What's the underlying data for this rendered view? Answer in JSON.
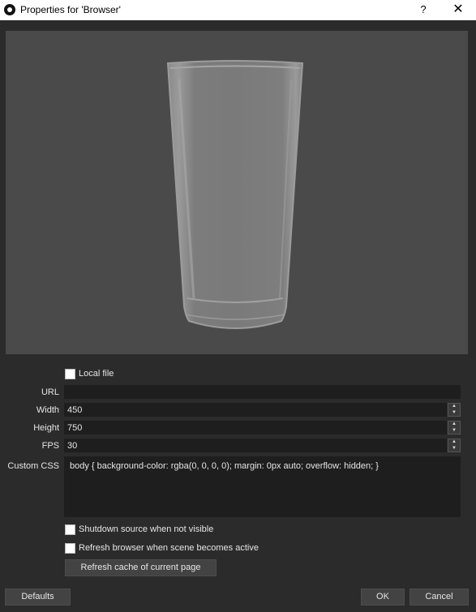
{
  "window": {
    "title": "Properties for 'Browser'",
    "help_label": "?",
    "close_label": "✕"
  },
  "form": {
    "local_file_label": "Local file",
    "local_file_checked": false,
    "url_label": "URL",
    "url_value": "",
    "width_label": "Width",
    "width_value": "450",
    "height_label": "Height",
    "height_value": "750",
    "fps_label": "FPS",
    "fps_value": "30",
    "custom_css_label": "Custom CSS",
    "custom_css_value": "body { background-color: rgba(0, 0, 0, 0); margin: 0px auto; overflow: hidden; }",
    "shutdown_label": "Shutdown source when not visible",
    "shutdown_checked": false,
    "refresh_active_label": "Refresh browser when scene becomes active",
    "refresh_active_checked": false,
    "refresh_cache_label": "Refresh cache of current page"
  },
  "footer": {
    "defaults_label": "Defaults",
    "ok_label": "OK",
    "cancel_label": "Cancel"
  },
  "colors": {
    "dialog_bg": "#2b2b2b",
    "preview_bg": "#4a4a4a",
    "field_bg": "#1e1e1e",
    "button_bg": "#434343"
  }
}
